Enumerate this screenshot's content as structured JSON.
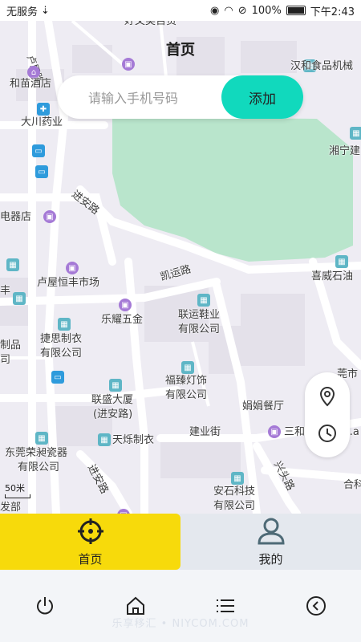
{
  "status": {
    "carrier": "无服务",
    "battery": "100%",
    "time": "下午2:43"
  },
  "header": {
    "title": "首页"
  },
  "search": {
    "placeholder": "请输入手机号码",
    "add_label": "添加"
  },
  "map": {
    "labels": [
      "卢屋路",
      "好文美百货",
      "和苗酒店",
      "大川药业",
      "汉和食品机械",
      "湘宁建",
      "进安路",
      "电器店",
      "卢屋恒丰市场",
      "凯运路",
      "喜威石油",
      "联运鞋业",
      "有限公司",
      "乐耀五金",
      "捷思制衣",
      "有限公司",
      "制品",
      "司",
      "丰",
      "福臻灯饰",
      "有限公司",
      "联盛大厦",
      "(进安路)",
      "娟娟餐厅",
      "东莞荣昶瓷器",
      "有限公司",
      "天烁制衣",
      "建业街",
      "三和",
      "安石科技",
      "有限公司",
      "进安路",
      "兴头路",
      "合科",
      "发部",
      "莞市",
      "o.a"
    ],
    "scale": "50米"
  },
  "tabs": [
    {
      "label": "首页"
    },
    {
      "label": "我的"
    }
  ],
  "watermark": "乐享移汇 • NIYCOM.COM"
}
